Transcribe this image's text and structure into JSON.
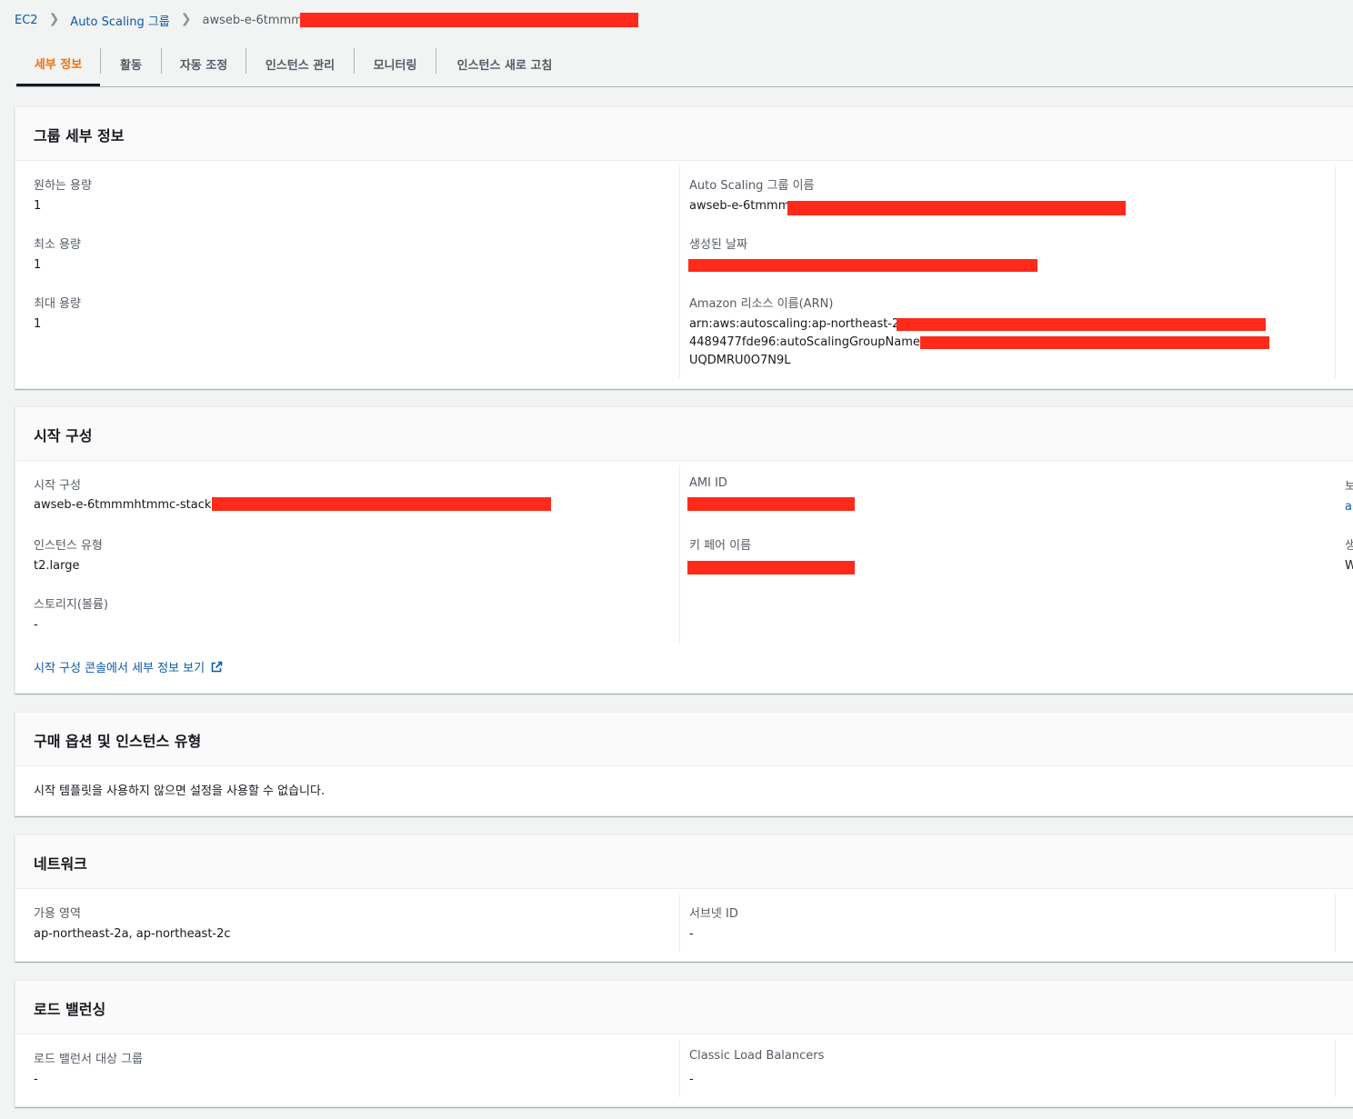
{
  "breadcrumb": {
    "items": [
      "EC2",
      "Auto Scaling 그룹"
    ],
    "current": "awseb-e-6tmmm"
  },
  "tabs": [
    "세부 정보",
    "활동",
    "자동 조정",
    "인스턴스 관리",
    "모니터링",
    "인스턴스 새로 고침"
  ],
  "group_details": {
    "title": "그룹 세부 정보",
    "desired_capacity_label": "원하는 용량",
    "desired_capacity": "1",
    "min_capacity_label": "최소 용량",
    "min_capacity": "1",
    "max_capacity_label": "최대 용량",
    "max_capacity": "1",
    "asg_name_label": "Auto Scaling 그룹 이름",
    "asg_name": "awseb-e-6tmmm",
    "created_label": "생성된 날짜",
    "arn_label": "Amazon 리소스 이름(ARN)",
    "arn_line1": "arn:aws:autoscaling:ap-northeast-2:",
    "arn_line2": "4489477fde96:autoScalingGroupName/",
    "arn_line3": "UQDMRU0O7N9L"
  },
  "launch_config": {
    "title": "시작 구성",
    "config_label": "시작 구성",
    "config_value": "awseb-e-6tmmmhtmmc-stack-",
    "instance_type_label": "인스턴스 유형",
    "instance_type": "t2.large",
    "storage_label": "스토리지(볼륨)",
    "storage": "-",
    "ami_label": "AMI ID",
    "key_pair_label": "키 페어 이름",
    "console_link": "시작 구성 콘솔에서 세부 정보 보기",
    "cut_col3_row1": "보",
    "cut_col3_row1_value": "a",
    "cut_col3_row2": "생",
    "cut_col3_row2_value": "W"
  },
  "purchase": {
    "title": "구매 옵션 및 인스턴스 유형",
    "message": "시작 템플릿을 사용하지 않으면 설정을 사용할 수 없습니다."
  },
  "network": {
    "title": "네트워크",
    "az_label": "가용 영역",
    "az_value": "ap-northeast-2a, ap-northeast-2c",
    "subnet_label": "서브넷 ID",
    "subnet_value": "-"
  },
  "load_balancing": {
    "title": "로드 밸런싱",
    "target_groups_label": "로드 밸런서 대상 그룹",
    "target_groups_value": "-",
    "classic_label": "Classic Load Balancers",
    "classic_value": "-"
  },
  "colors": {
    "accent": "#ec7211",
    "link": "#0a5ba8",
    "redaction": "#ff2a1a"
  }
}
